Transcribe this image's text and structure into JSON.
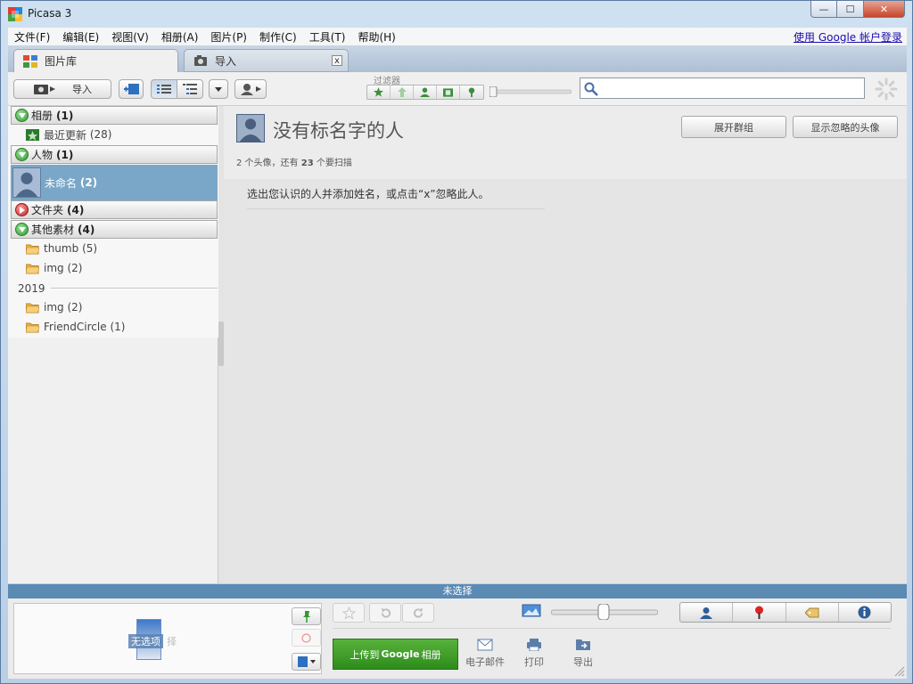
{
  "window": {
    "title": "Picasa 3",
    "controls": {
      "minimize": "—",
      "maximize": "☐",
      "close": "✕"
    }
  },
  "menu": {
    "items": [
      "文件(F)",
      "编辑(E)",
      "视图(V)",
      "相册(A)",
      "图片(P)",
      "制作(C)",
      "工具(T)",
      "帮助(H)"
    ],
    "login_link": "使用 Google 帐户登录"
  },
  "tabs": [
    {
      "label": "图片库",
      "active": true
    },
    {
      "label": "导入",
      "active": false,
      "close": "x"
    }
  ],
  "toolbar": {
    "import_label": "导入",
    "filter_label": "过滤器",
    "search": {
      "value": "",
      "placeholder": ""
    }
  },
  "sidebar": {
    "groups": {
      "albums": {
        "label": "相册",
        "count": "(1)"
      },
      "people": {
        "label": "人物",
        "count": "(1)"
      },
      "folders": {
        "label": "文件夹",
        "count": "(4)"
      },
      "other": {
        "label": "其他素材",
        "count": "(4)"
      }
    },
    "items": {
      "recent": {
        "label": "最近更新",
        "count": "(28)"
      },
      "unnamed": {
        "label": "未命名",
        "count": "(2)"
      },
      "thumb": {
        "label": "thumb",
        "count": "(5)"
      },
      "img1": {
        "label": "img",
        "count": "(2)"
      },
      "year": "2019",
      "img2": {
        "label": "img",
        "count": "(2)"
      },
      "friendcircle": {
        "label": "FriendCircle",
        "count": "(1)"
      }
    }
  },
  "main": {
    "title": "没有标名字的人",
    "subtitle": {
      "faces_count": "2",
      "faces_text": " 个头像，还有 ",
      "remaining_count": "23",
      "remaining_text": " 个要扫描"
    },
    "expand_groups_button": "展开群组",
    "show_ignored_button": "显示忽略的头像",
    "instruction": "选出您认识的人并添加姓名，或点击“x”忽略此人。"
  },
  "status": "未选择",
  "tray": {
    "selected_label": "无选项",
    "ghost_label": "择"
  },
  "bottom": {
    "upload_prefix": "上传到",
    "upload_brand": "Google",
    "upload_suffix": "相册",
    "email_label": "电子邮件",
    "print_label": "打印",
    "export_label": "导出"
  },
  "colors": {
    "selection": "#7aa7c7",
    "status_bar": "#5b8ab3",
    "upload_green": "#3c9e28",
    "link": "#1a0dab"
  }
}
